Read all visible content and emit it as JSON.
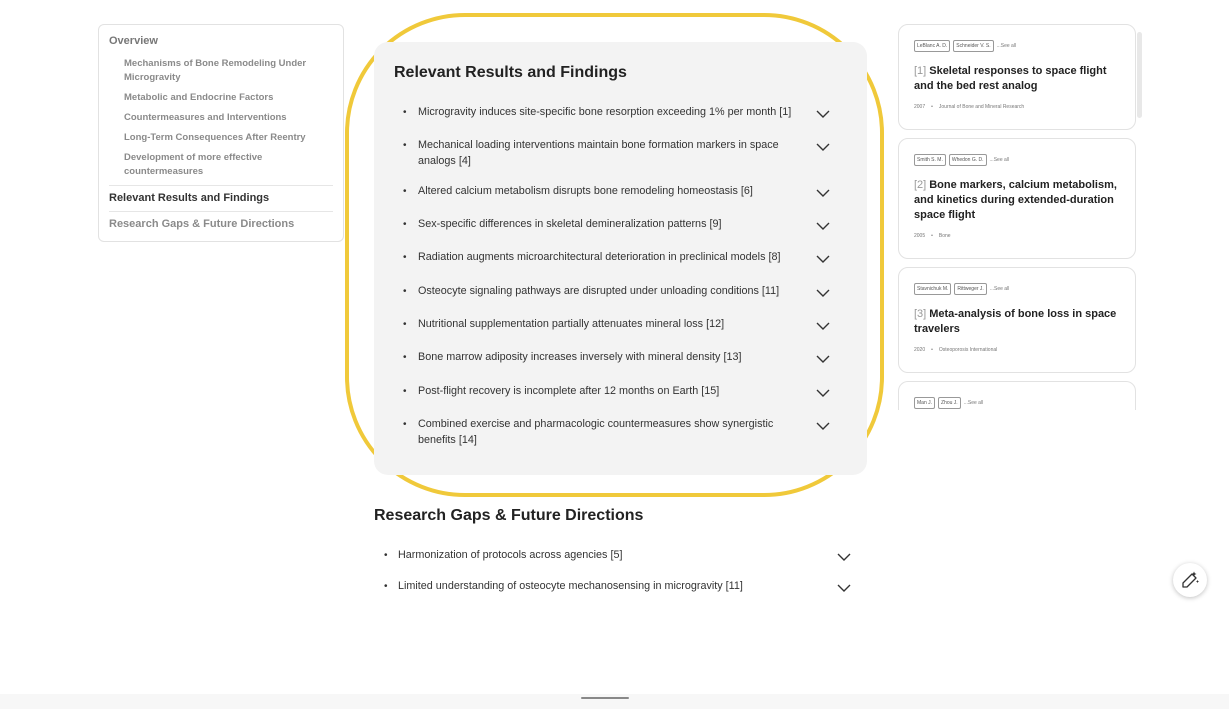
{
  "toc": {
    "overview": "Overview",
    "subitems": [
      "Mechanisms of Bone Remodeling Under Microgravity",
      "Metabolic and Endocrine Factors",
      "Countermeasures and Interventions",
      "Long-Term Consequences After Reentry",
      "Development of more effective countermeasures"
    ],
    "sections": [
      "Relevant Results and Findings",
      "Research Gaps & Future Directions"
    ]
  },
  "results": {
    "title": "Relevant Results and Findings",
    "items": [
      "Microgravity induces site-specific bone resorption exceeding 1% per month [1]",
      "Mechanical loading interventions maintain bone formation markers in space analogs [4]",
      "Altered calcium metabolism disrupts bone remodeling homeostasis [6]",
      "Sex-specific differences in skeletal demineralization patterns [9]",
      "Radiation augments microarchitectural deterioration in preclinical models [8]",
      "Osteocyte signaling pathways are disrupted under unloading conditions [11]",
      "Nutritional supplementation partially attenuates mineral loss [12]",
      "Bone marrow adiposity increases inversely with mineral density [13]",
      "Post-flight recovery is incomplete after 12 months on Earth [15]",
      "Combined exercise and pharmacologic countermeasures show synergistic benefits [14]"
    ]
  },
  "gaps": {
    "title": "Research Gaps & Future Directions",
    "items": [
      "Harmonization of protocols across agencies [5]",
      "Limited understanding of osteocyte mechanosensing in microgravity [11]"
    ]
  },
  "references": [
    {
      "authors": [
        "LeBlanc A. D.",
        "Schneider V. S."
      ],
      "see_all": "...See all",
      "num": "[1]",
      "title": "Skeletal responses to space flight and the bed rest analog",
      "year": "2007",
      "journal": "Journal of Bone and Mineral Research"
    },
    {
      "authors": [
        "Smith S. M.",
        "Whedon G. D."
      ],
      "see_all": "...See all",
      "num": "[2]",
      "title": "Bone markers, calcium metabolism, and kinetics during extended-duration space flight",
      "year": "2005",
      "journal": "Bone"
    },
    {
      "authors": [
        "Stavnichuk M.",
        "Rittweger J."
      ],
      "see_all": "...See all",
      "num": "[3]",
      "title": "Meta-analysis of bone loss in space travelers",
      "year": "2020",
      "journal": "Osteoporosis International"
    },
    {
      "authors": [
        "Man J.",
        "Zhou J."
      ],
      "see_all": "...See all"
    }
  ],
  "colors": {
    "highlight": "#f0c93a",
    "panel": "#f3f3f3"
  },
  "icons": {
    "chevron": "chevron-down-icon",
    "fab": "ai-sparkle-icon"
  }
}
